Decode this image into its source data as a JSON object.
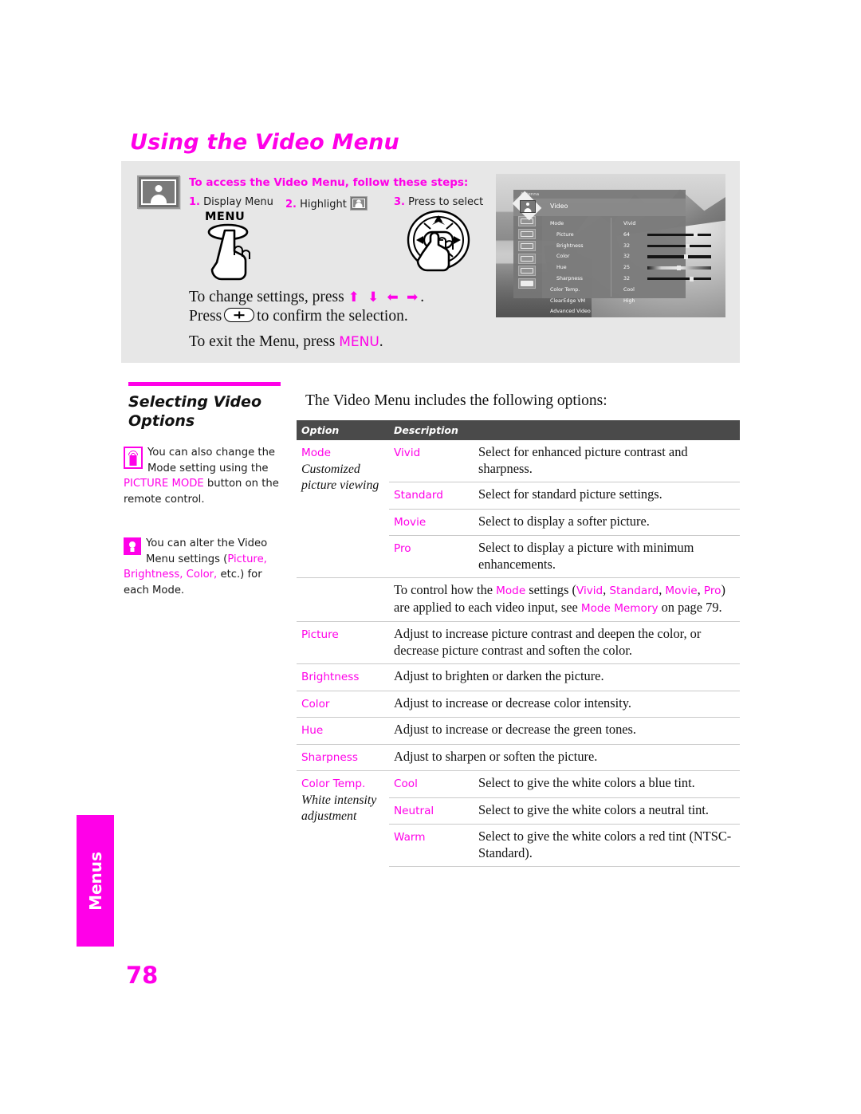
{
  "page": {
    "title": "Using the Video Menu",
    "number": "78",
    "side_tab": "Menus",
    "accent_color": "#FF00E8"
  },
  "steps_panel": {
    "heading": "To access the Video Menu, follow these steps:",
    "steps": [
      {
        "num": "1.",
        "label": "Display Menu"
      },
      {
        "num": "2.",
        "label": "Highlight"
      },
      {
        "num": "3.",
        "label": "Press to select"
      }
    ],
    "menu_button_label": "MENU",
    "instructions": {
      "line1_a": "To change settings, press",
      "line1_arrows": "⬆ ⬇ ⬅ ➡",
      "line1_b": ".",
      "line2_a": "Press",
      "line2_b": "to confirm the selection.",
      "line3_a": "To exit the Menu, press",
      "line3_kw": "MENU",
      "line3_b": "."
    }
  },
  "tv_osd": {
    "antenna_label": "Antenna",
    "selected_menu": "Video",
    "rows": [
      {
        "name": "Mode",
        "value": "Vivid",
        "bar": false,
        "indent": false
      },
      {
        "name": "Picture",
        "value": "64",
        "bar": true,
        "pct": 72,
        "indent": true
      },
      {
        "name": "Brightness",
        "value": "32",
        "bar": true,
        "pct": 60,
        "indent": true
      },
      {
        "name": "Color",
        "value": "32",
        "bar": true,
        "pct": 58,
        "indent": true
      },
      {
        "name": "Hue",
        "value": "25",
        "bar": true,
        "pct": 46,
        "indent": true,
        "gradient": true
      },
      {
        "name": "Sharpness",
        "value": "32",
        "bar": true,
        "pct": 66,
        "indent": true
      },
      {
        "name": "Color Temp.",
        "value": "Cool",
        "bar": false,
        "indent": false
      },
      {
        "name": "ClearEdge VM",
        "value": "High",
        "bar": false,
        "indent": false
      },
      {
        "name": "Advanced Video",
        "value": "",
        "bar": false,
        "indent": false
      }
    ]
  },
  "left_column": {
    "section_title": "Selecting Video Options",
    "note1": {
      "icon": "remote-control-icon",
      "text_a": "You can also change the Mode setting using the ",
      "kw": "PICTURE MODE",
      "text_b": " button on the remote control."
    },
    "note2": {
      "icon": "lightbulb-icon",
      "text_a": "You can alter the Video Menu settings (",
      "kw": "Picture, Brightness, Color,",
      "text_b": " etc.) for each Mode."
    }
  },
  "table": {
    "intro": "The Video Menu includes the following options:",
    "headers": {
      "option": "Option",
      "description": "Description"
    },
    "rows": [
      {
        "option": "Mode",
        "option_sub": "Customized picture viewing",
        "value": "Vivid",
        "desc": "Select for enhanced picture contrast and sharpness."
      },
      {
        "option": "",
        "value": "Standard",
        "desc": "Select for standard picture settings."
      },
      {
        "option": "",
        "value": "Movie",
        "desc": "Select to display a softer picture."
      },
      {
        "option": "",
        "value": "Pro",
        "desc": "Select to display a picture with minimum enhancements."
      }
    ],
    "mode_memory_note": {
      "a": "To control how the ",
      "k1": "Mode",
      "b": " settings (",
      "k2": "Vivid",
      "c": ", ",
      "k3": "Standard",
      "d": ", ",
      "k4": "Movie",
      "e": ", ",
      "k5": "Pro",
      "f": ") are applied to each video input, see ",
      "k6": "Mode Memory",
      "g": " on page 79."
    },
    "simple_rows": [
      {
        "option": "Picture",
        "desc": "Adjust to increase picture contrast and deepen the color, or decrease picture contrast and soften the color."
      },
      {
        "option": "Brightness",
        "desc": "Adjust to brighten or darken the picture."
      },
      {
        "option": "Color",
        "desc": "Adjust to increase or decrease color intensity."
      },
      {
        "option": "Hue",
        "desc": "Adjust to increase or decrease the green tones."
      },
      {
        "option": "Sharpness",
        "desc": "Adjust to sharpen or soften the picture."
      }
    ],
    "color_temp": {
      "option": "Color Temp.",
      "option_sub": "White intensity adjustment",
      "rows": [
        {
          "value": "Cool",
          "desc": "Select to give the white colors a blue tint."
        },
        {
          "value": "Neutral",
          "desc": "Select to give the white colors a neutral tint."
        },
        {
          "value": "Warm",
          "desc": "Select to give the white colors a red tint (NTSC-Standard)."
        }
      ]
    }
  }
}
